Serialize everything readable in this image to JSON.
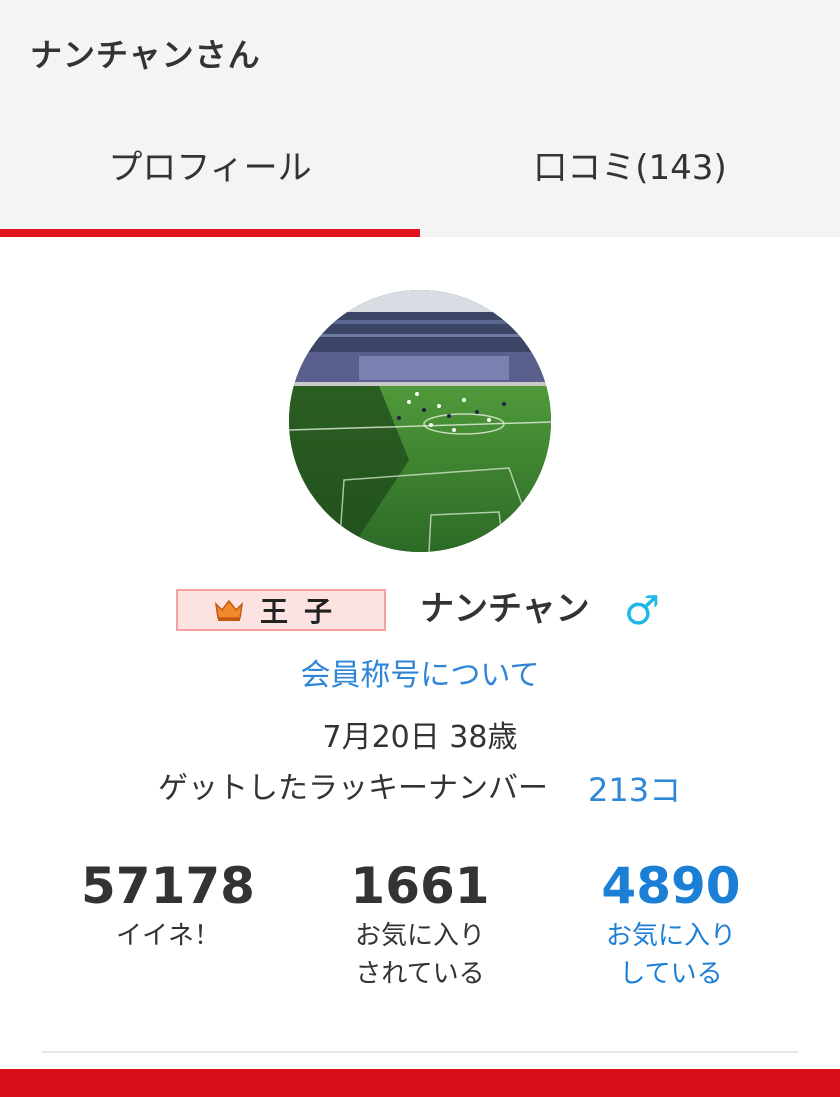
{
  "header": {
    "title": "ナンチャンさん"
  },
  "tabs": [
    {
      "label": "プロフィール",
      "active": true
    },
    {
      "label": "口コミ(143)",
      "active": false
    }
  ],
  "profile": {
    "rank_badge": "王子",
    "username": "ナンチャン",
    "gender_symbol": "♂",
    "title_link": "会員称号について",
    "birth_age": "7月20日 38歳",
    "lucky_label": "ゲットしたラッキーナンバー",
    "lucky_value": "213コ"
  },
  "stats": [
    {
      "value": "57178",
      "label_line1": "イイネ！",
      "label_line2": ""
    },
    {
      "value": "1661",
      "label_line1": "お気に入り",
      "label_line2": "されている"
    },
    {
      "value": "4890",
      "label_line1": "お気に入り",
      "label_line2": "している"
    }
  ],
  "colors": {
    "accent_red": "#e0141b",
    "link_blue": "#2f86d6",
    "gender_cyan": "#1fb8e6"
  }
}
